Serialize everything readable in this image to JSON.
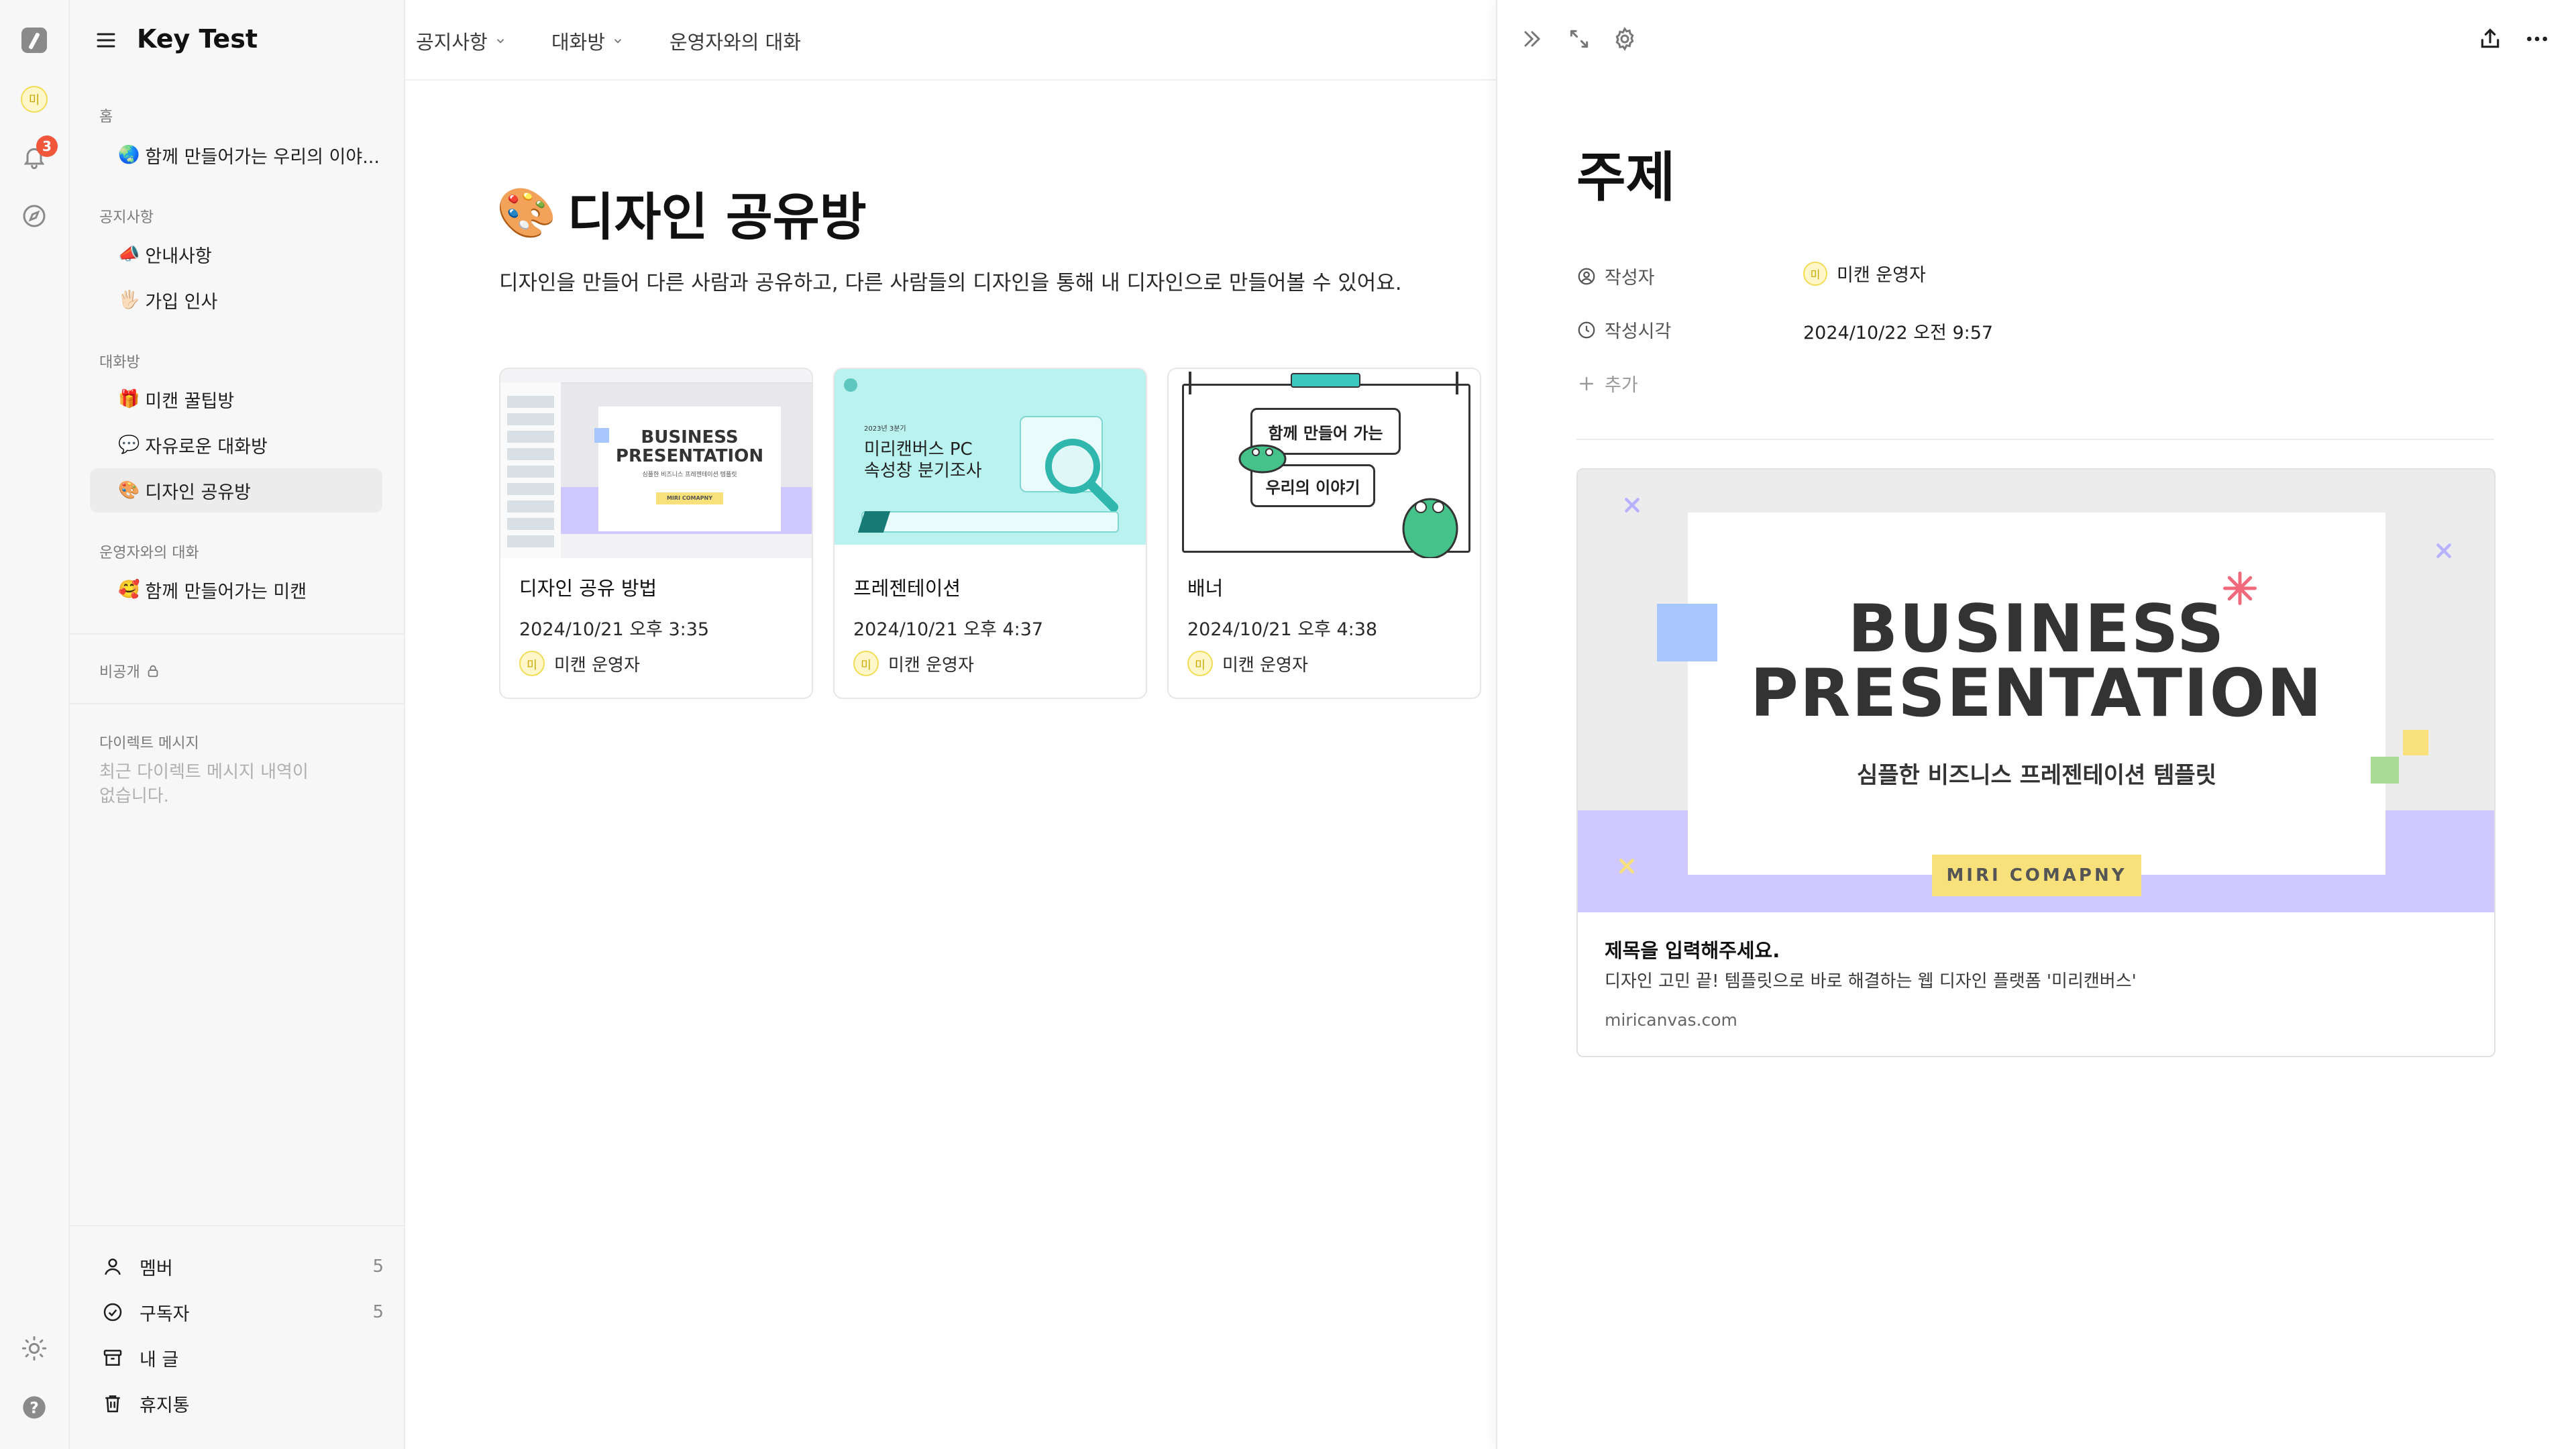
{
  "app": {
    "title": "Key Test",
    "avatar_text": "미",
    "notification_count": "3"
  },
  "topnav": {
    "items": [
      "공지사항",
      "대화방",
      "운영자와의 대화"
    ]
  },
  "sidebar": {
    "sections": [
      {
        "label": "홈",
        "items": [
          {
            "emoji": "🌏",
            "label": "함께 만들어가는 우리의 이야..."
          }
        ]
      },
      {
        "label": "공지사항",
        "items": [
          {
            "emoji": "📣",
            "label": "안내사항"
          },
          {
            "emoji": "🖐🏻",
            "label": "가입 인사"
          }
        ]
      },
      {
        "label": "대화방",
        "items": [
          {
            "emoji": "🎁",
            "label": "미캔 꿀팁방"
          },
          {
            "emoji": "💬",
            "label": "자유로운 대화방"
          },
          {
            "emoji": "🎨",
            "label": "디자인 공유방"
          }
        ]
      },
      {
        "label": "운영자와의 대화",
        "items": [
          {
            "emoji": "🥰",
            "label": "함께 만들어가는 미캔"
          }
        ]
      }
    ],
    "private_label": "비공개",
    "dm_label": "다이렉트 메시지",
    "dm_empty_line1": "최근 다이렉트 메시지 내역이",
    "dm_empty_line2": "없습니다.",
    "bottom": [
      {
        "label": "멤버",
        "count": "5"
      },
      {
        "label": "구독자",
        "count": "5"
      },
      {
        "label": "내 글",
        "count": ""
      },
      {
        "label": "휴지통",
        "count": ""
      }
    ]
  },
  "page": {
    "emoji": "🎨",
    "title": "디자인 공유방",
    "description": "디자인을 만들어 다른 사람과 공유하고, 다른 사람들의 디자인을 통해 내 디자인으로 만들어볼 수 있어요.",
    "cards": [
      {
        "title": "디자인 공유 방법",
        "date": "2024/10/21 오후 3:35",
        "author": "미캔 운영자",
        "author_avatar": "미",
        "thumb_line1": "BUSINESS",
        "thumb_line2": "PRESENTATION",
        "thumb_sub": "심플한 비즈니스 프레젠테이션 템플릿",
        "thumb_badge": "MIRI COMAPNY"
      },
      {
        "title": "프레젠테이션",
        "date": "2024/10/21 오후 4:37",
        "author": "미캔 운영자",
        "author_avatar": "미",
        "thumb_small": "2023년 3분기",
        "thumb_line1": "미리캔버스 PC",
        "thumb_line2": "속성창 분기조사"
      },
      {
        "title": "배너",
        "date": "2024/10/21 오후 4:38",
        "author": "미캔 운영자",
        "author_avatar": "미",
        "thumb_line1": "함께 만들어 가는",
        "thumb_line2": "우리의 이야기"
      }
    ]
  },
  "detail": {
    "title": "주제",
    "props": [
      {
        "label": "작성자",
        "value": "미캔 운영자",
        "avatar": "미"
      },
      {
        "label": "작성시각",
        "value": "2024/10/22 오전 9:57"
      }
    ],
    "add_label": "추가",
    "link_preview": {
      "image_line1": "BUSINESS",
      "image_line2": "PRESENTATION",
      "image_sub": "심플한 비즈니스 프레젠테이션 템플릿",
      "image_badge": "MIRI COMAPNY",
      "title": "제목을 입력해주세요.",
      "description": "디자인 고민 끝! 템플릿으로 바로 해결하는 웹 디자인 플랫폼 '미리캔버스'",
      "url": "miricanvas.com"
    }
  },
  "colors": {
    "accent_lavender": "#cfc9ff",
    "badge_red": "#f1573a",
    "badge_yellow": "#f8e07a",
    "card_border": "#e6e6e6"
  },
  "icons": [
    "logo-icon",
    "bell-icon",
    "compass-icon",
    "sun-icon",
    "help-icon",
    "hamburger-icon",
    "chevron-down-icon",
    "double-chevron-right-icon",
    "expand-icon",
    "gear-icon",
    "share-icon",
    "more-icon",
    "lock-icon",
    "user-icon",
    "check-circle-icon",
    "archive-icon",
    "trash-icon",
    "clock-icon",
    "plus-icon"
  ]
}
